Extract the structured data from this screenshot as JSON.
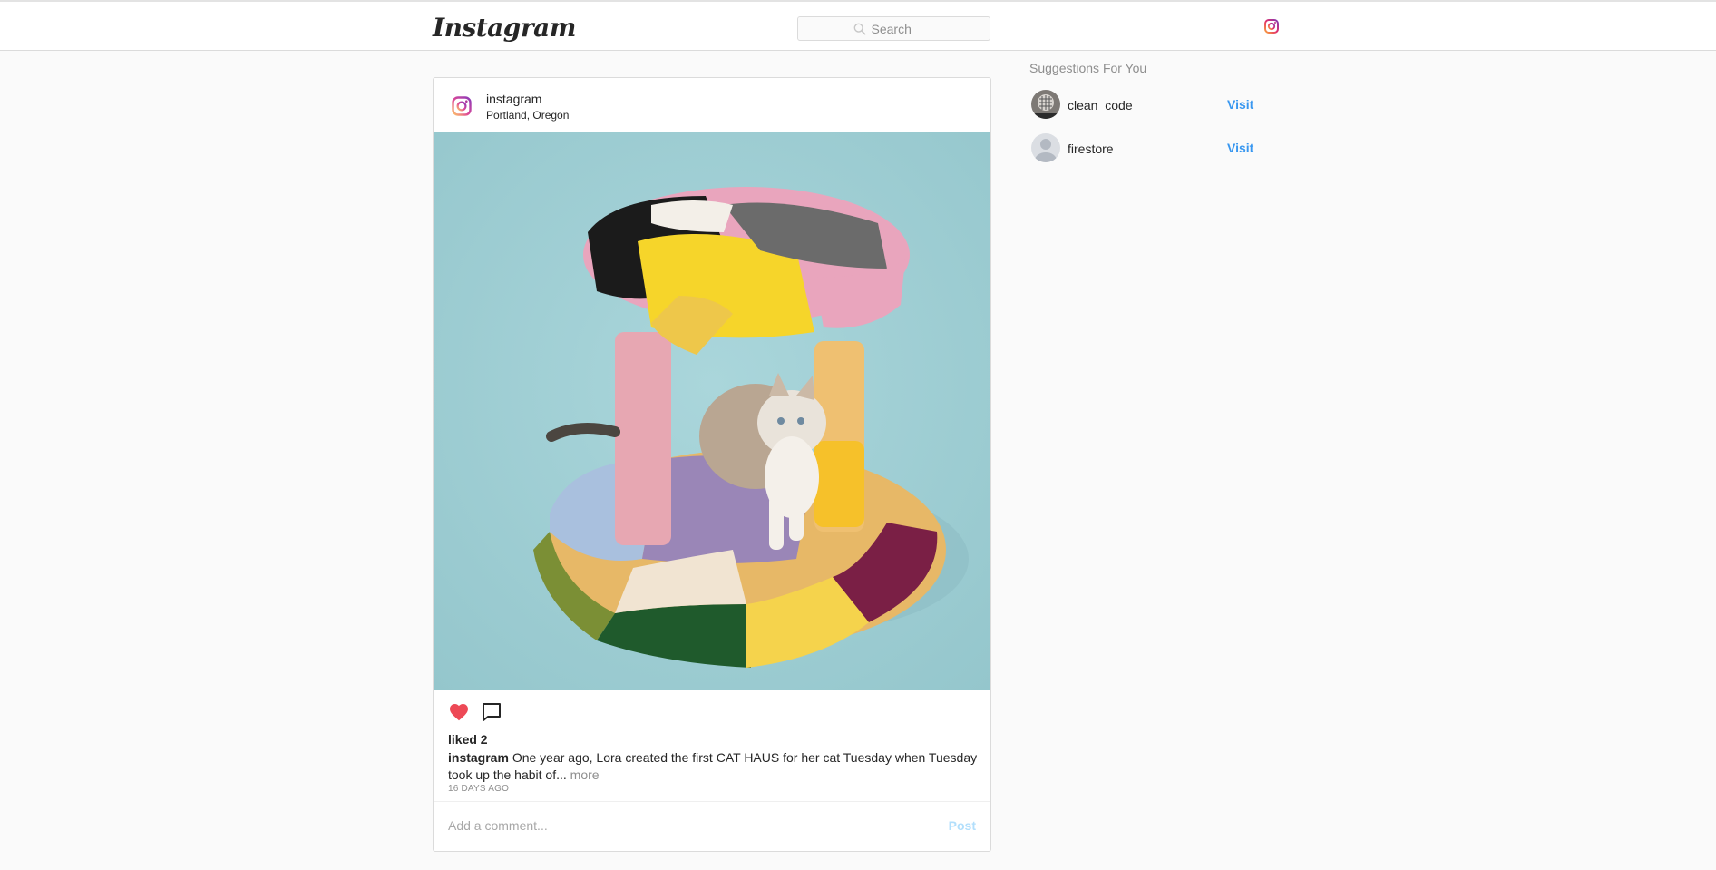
{
  "header": {
    "logo": "Instagram",
    "search_placeholder": "Search",
    "nav_icon": "instagram-icon"
  },
  "post": {
    "username": "instagram",
    "location": "Portland, Oregon",
    "likes": "liked 2",
    "caption_user": "instagram",
    "caption_text": "One year ago, Lora created the first CAT HAUS for her cat Tuesday when Tuesday took up the habit of...",
    "more_label": "more",
    "timestamp": "16 DAYS AGO",
    "comment_placeholder": "Add a comment...",
    "post_label": "Post",
    "liked": true
  },
  "suggestions": {
    "title": "Suggestions For You",
    "items": [
      {
        "username": "clean_code",
        "action": "Visit"
      },
      {
        "username": "firestore",
        "action": "Visit"
      }
    ]
  },
  "colors": {
    "like": "#ed4956",
    "link": "#3897f0",
    "post_disabled": "#b2dffc",
    "photo_background": "#9ecdd3"
  }
}
